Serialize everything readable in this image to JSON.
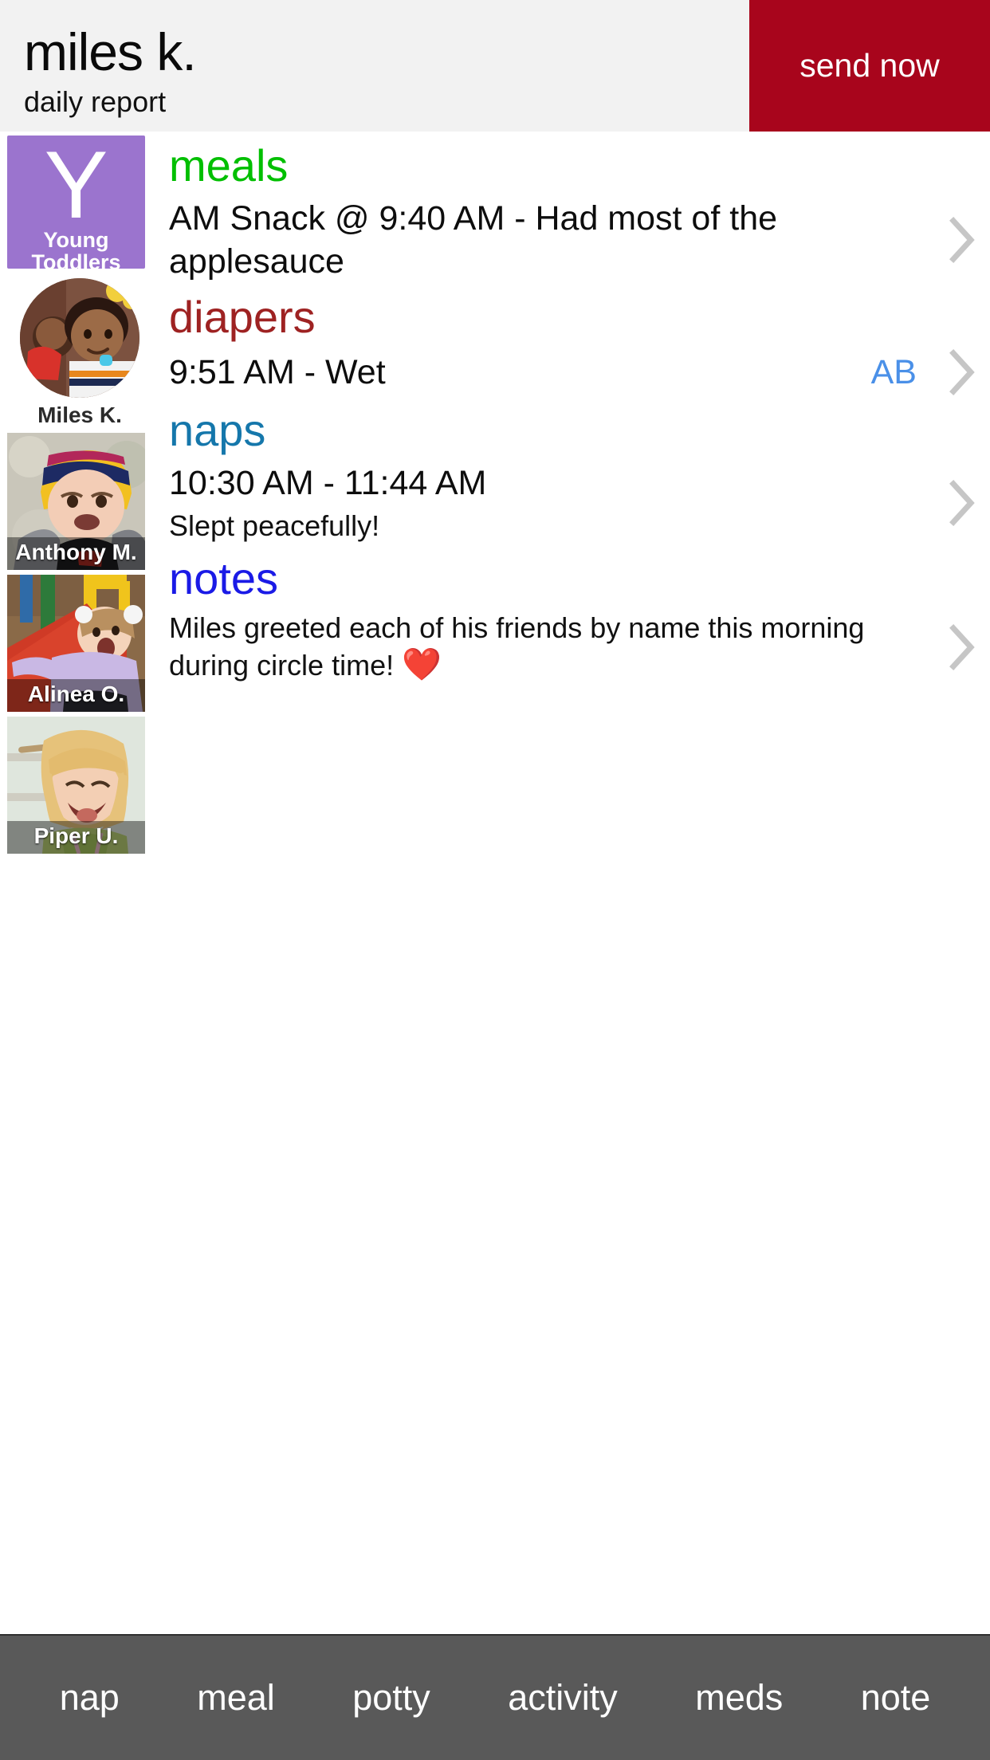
{
  "header": {
    "child_name": "miles k.",
    "subtitle": "daily report",
    "send_button_label": "send now",
    "send_button_color": "#a8051c",
    "bar_color": "#f2f2f2"
  },
  "sidebar": {
    "room": {
      "letter": "Y",
      "name_line1": "Young",
      "name_line2": "Toddlers",
      "color": "#9b74ce"
    },
    "selected_child": {
      "caption": "Miles K.",
      "avatar": "miles-avatar"
    },
    "children": [
      {
        "caption": "Anthony M.",
        "thumb": "anthony-thumb"
      },
      {
        "caption": "Alinea O.",
        "thumb": "alinea-thumb"
      },
      {
        "caption": "Piper U.",
        "thumb": "piper-thumb"
      }
    ]
  },
  "sections": {
    "meals": {
      "title": "meals",
      "color": "#00bf00",
      "entry": "AM Snack @ 9:40 AM - Had most of the applesauce"
    },
    "diapers": {
      "title": "diapers",
      "color": "#9e2222",
      "entry": "9:51 AM - Wet",
      "initials": "AB",
      "initials_color": "#4a90e8"
    },
    "naps": {
      "title": "naps",
      "color": "#1577ab",
      "entry": "10:30 AM - 11:44 AM",
      "detail": "Slept peacefully!"
    },
    "notes": {
      "title": "notes",
      "color": "#1a1ae6",
      "entry": "Miles greeted each of his friends by name this morning during circle time!",
      "emoji": "❤️"
    }
  },
  "toolbar": {
    "background": "#595959",
    "items": [
      {
        "label": "nap"
      },
      {
        "label": "meal"
      },
      {
        "label": "potty"
      },
      {
        "label": "activity"
      },
      {
        "label": "meds"
      },
      {
        "label": "note"
      }
    ]
  }
}
